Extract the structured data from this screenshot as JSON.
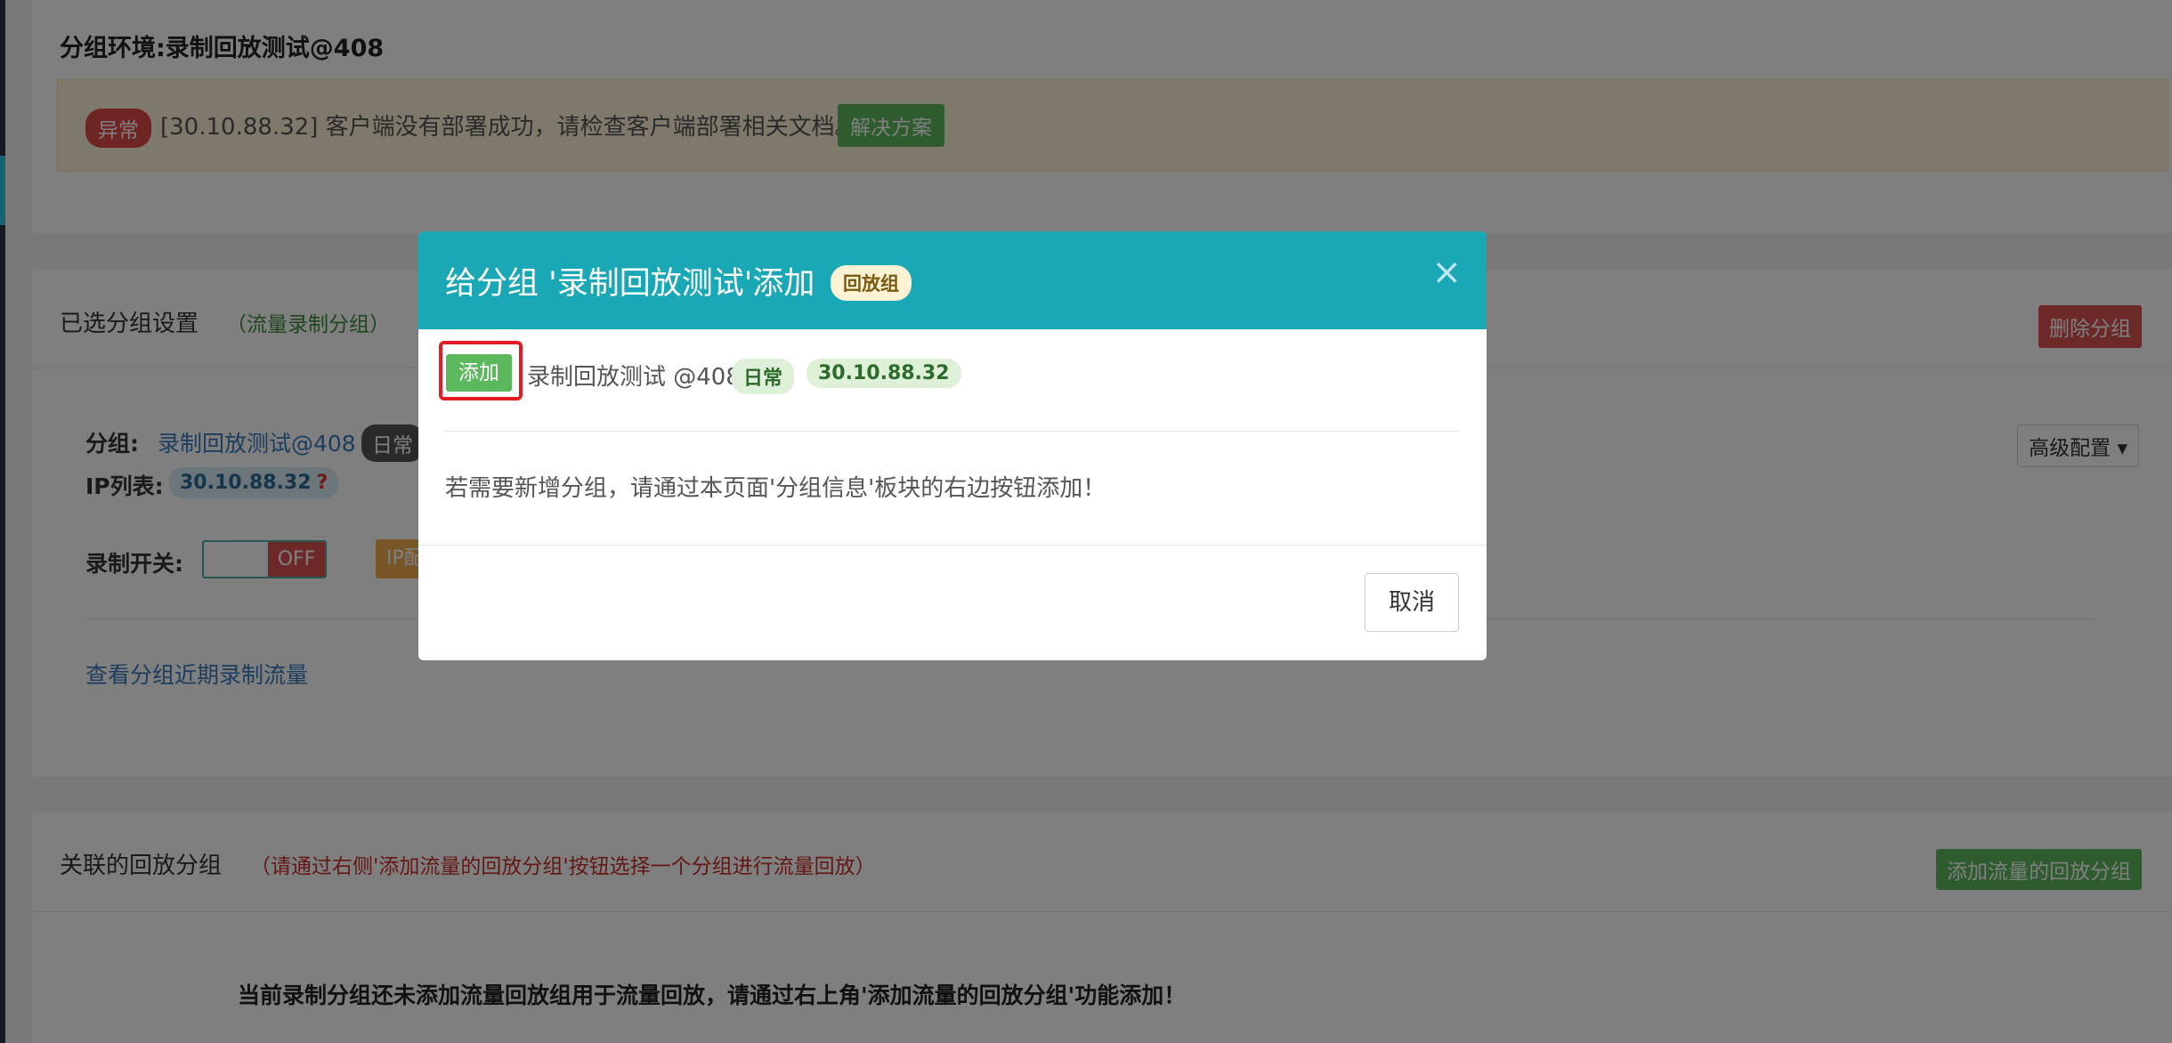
{
  "env": {
    "title": "分组环境:录制回放测试@408",
    "alert_badge": "异常",
    "alert_message": "[30.10.88.32] 客户端没有部署成功，请检查客户端部署相关文档。",
    "solution_button": "解决方案"
  },
  "selected": {
    "title": "已选分组设置",
    "subtitle": "（流量录制分组）",
    "delete_button": "删除分组",
    "group_label": "分组:",
    "group_value": "录制回放测试@408",
    "group_env_tag": "日常",
    "ip_label": "IP列表:",
    "ip_value": "30.10.88.32",
    "ip_help": "?",
    "record_label": "录制开关:",
    "toggle_state": "OFF",
    "ip_button_partial": "IP配",
    "advanced_button": "高级配置",
    "recent_link": "查看分组近期录制流量"
  },
  "related": {
    "title": "关联的回放分组",
    "subtitle": "（请通过右侧'添加流量的回放分组'按钮选择一个分组进行流量回放）",
    "add_button": "添加流量的回放分组",
    "empty_note": "当前录制分组还未添加流量回放组用于流量回放，请通过右上角'添加流量的回放分组'功能添加！"
  },
  "modal": {
    "title": "给分组 '录制回放测试'添加",
    "title_tag": "回放组",
    "close_symbol": "×",
    "add_button": "添加",
    "group_name": "录制回放测试 @408",
    "env_tag": "日常",
    "ip_tag": "30.10.88.32",
    "tip": "若需要新增分组，请通过本页面'分组信息'板块的右边按钮添加！",
    "cancel_button": "取消"
  },
  "colors": {
    "modal_header": "#1aa7b6",
    "success": "#5cb85c",
    "danger": "#d9534f",
    "highlight": "#e41b23"
  }
}
